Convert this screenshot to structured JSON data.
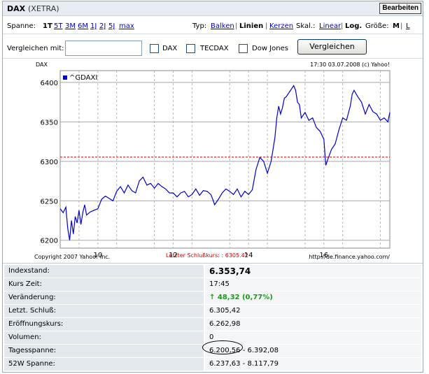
{
  "header": {
    "title": "DAX",
    "subtitle": "(XETRA)",
    "edit_label": "Bearbeiten"
  },
  "spanne": {
    "label": "Spanne:",
    "options": [
      "1T",
      "5T",
      "3M",
      "6M",
      "1J",
      "2J",
      "5J",
      "max"
    ],
    "selected": "1T"
  },
  "typ": {
    "label": "Typ:",
    "options": [
      "Balken",
      "Linien",
      "Kerzen"
    ],
    "selected": "Linien"
  },
  "skala": {
    "label": "Skal.:",
    "options": [
      "Linear",
      "Log."
    ],
    "selected": "Log."
  },
  "groesse": {
    "label": "Größe:",
    "options": [
      "M",
      "L"
    ],
    "selected": "M"
  },
  "compare": {
    "label": "Vergleichen mit:",
    "input_value": "",
    "checkboxes": [
      {
        "label": "DAX",
        "checked": false
      },
      {
        "label": "TECDAX",
        "checked": false
      },
      {
        "label": "Dow Jones",
        "checked": false
      }
    ],
    "button_label": "Vergleichen"
  },
  "chart_data": {
    "type": "line",
    "ylabel": "DAX",
    "timestamp": "17:30 03.07.2008 (c) Yahoo!",
    "legend": "^GDAXI",
    "copyright": "Copyright 2007 Yahoo! Inc.",
    "source": "http://de.finance.yahoo.com/",
    "prev_close_label": "Letzter Schlußkurs: : 6305.42",
    "prev_close": 6305.42,
    "ylim": [
      6190,
      6415
    ],
    "xlim": [
      9.0,
      17.75
    ],
    "yticks": [
      6200,
      6250,
      6300,
      6350,
      6400
    ],
    "xticks": [
      10,
      12,
      14,
      16
    ],
    "colors": {
      "line": "#0000cc",
      "prev_close": "#cc0000"
    },
    "series": [
      {
        "name": "^GDAXI",
        "x": [
          9.0,
          9.08,
          9.15,
          9.2,
          9.25,
          9.3,
          9.35,
          9.4,
          9.45,
          9.5,
          9.55,
          9.6,
          9.65,
          9.7,
          9.8,
          9.9,
          10.0,
          10.1,
          10.2,
          10.3,
          10.4,
          10.5,
          10.6,
          10.7,
          10.8,
          10.9,
          11.0,
          11.1,
          11.2,
          11.3,
          11.4,
          11.5,
          11.6,
          11.7,
          11.8,
          11.9,
          12.0,
          12.1,
          12.2,
          12.3,
          12.4,
          12.5,
          12.6,
          12.7,
          12.8,
          12.9,
          13.0,
          13.05,
          13.1,
          13.2,
          13.3,
          13.4,
          13.5,
          13.6,
          13.7,
          13.8,
          13.9,
          14.0,
          14.1,
          14.2,
          14.3,
          14.4,
          14.5,
          14.6,
          14.7,
          14.75,
          14.8,
          14.85,
          14.9,
          14.95,
          15.0,
          15.1,
          15.2,
          15.25,
          15.3,
          15.35,
          15.4,
          15.5,
          15.6,
          15.7,
          15.8,
          15.9,
          16.0,
          16.05,
          16.1,
          16.2,
          16.3,
          16.4,
          16.5,
          16.6,
          16.7,
          16.75,
          16.8,
          16.9,
          17.0,
          17.1,
          17.2,
          17.3,
          17.4,
          17.5,
          17.6,
          17.7,
          17.75
        ],
        "y": [
          6240,
          6235,
          6242,
          6215,
          6200,
          6225,
          6208,
          6230,
          6222,
          6238,
          6220,
          6235,
          6245,
          6232,
          6236,
          6238,
          6240,
          6252,
          6256,
          6253,
          6250,
          6262,
          6268,
          6260,
          6270,
          6263,
          6260,
          6275,
          6280,
          6270,
          6272,
          6266,
          6272,
          6268,
          6265,
          6260,
          6260,
          6255,
          6260,
          6262,
          6255,
          6258,
          6265,
          6257,
          6263,
          6262,
          6258,
          6252,
          6245,
          6252,
          6260,
          6265,
          6262,
          6258,
          6265,
          6255,
          6262,
          6258,
          6264,
          6290,
          6305,
          6300,
          6285,
          6300,
          6330,
          6355,
          6370,
          6360,
          6368,
          6380,
          6382,
          6389,
          6396,
          6390,
          6375,
          6372,
          6355,
          6362,
          6352,
          6355,
          6343,
          6338,
          6328,
          6295,
          6302,
          6315,
          6322,
          6340,
          6355,
          6352,
          6370,
          6385,
          6390,
          6382,
          6375,
          6360,
          6372,
          6363,
          6360,
          6352,
          6355,
          6350,
          6362
        ]
      }
    ]
  },
  "stats": [
    {
      "key": "Indexstand:",
      "value": "6.353,74"
    },
    {
      "key": "Kurs Zeit:",
      "value": "17:45"
    },
    {
      "key": "Veränderung:",
      "value": "48,32 (0,77%)"
    },
    {
      "key": "Letzt. Schluß:",
      "value": "6.305,42"
    },
    {
      "key": "Eröffnungskurs:",
      "value": "6.262,98"
    },
    {
      "key": "Volumen:",
      "value": "0"
    },
    {
      "key": "Tagesspanne:",
      "value": "6.200,56 - 6.392,08"
    },
    {
      "key": "52W Spanne:",
      "value": "6.237,63 - 8.117,79"
    }
  ]
}
